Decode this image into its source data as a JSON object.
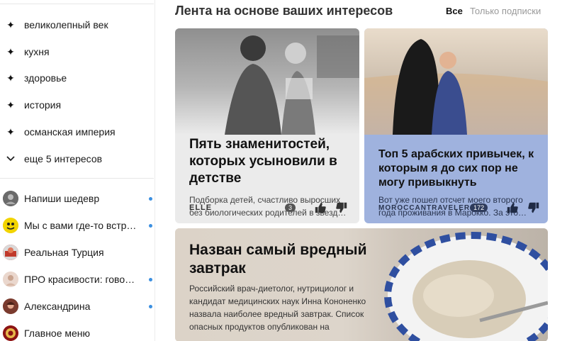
{
  "sidebar": {
    "topics": [
      {
        "label": "великолепный век",
        "icon": "sparkle-icon"
      },
      {
        "label": "кухня",
        "icon": "sparkle-icon"
      },
      {
        "label": "здоровье",
        "icon": "sparkle-icon"
      },
      {
        "label": "история",
        "icon": "sparkle-icon"
      },
      {
        "label": "османская империя",
        "icon": "sparkle-icon"
      }
    ],
    "more_label": "еще 5 интересов",
    "channels": [
      {
        "label": "Напиши шедевр",
        "unread": true
      },
      {
        "label": "Мы с вами где-то встреч…",
        "unread": true
      },
      {
        "label": "Реальная Турция",
        "unread": false
      },
      {
        "label": "ПРО красивости: говор…",
        "unread": true
      },
      {
        "label": "Александрина",
        "unread": true
      },
      {
        "label": "Главное меню",
        "unread": false
      }
    ]
  },
  "header": {
    "title": "Лента на основе ваших интересов",
    "filter_all": "Все",
    "filter_subscriptions": "Только подписки"
  },
  "cards": [
    {
      "title": "Пять знаменитостей, которых усыновили в детстве",
      "description": "Подборка детей, счастливо выросших без биологических родителей в звезд…",
      "source": "ELLE",
      "comments": "3"
    },
    {
      "title": "Топ 5 арабских привычек, к которым я до сих пор не могу привыкнуть",
      "description": "Вот уже пошел отсчет моего второго года проживания в Марокко. За это…",
      "source": "MOROCCANTRAVELER",
      "comments": "172"
    },
    {
      "title": "Назван самый вредный завтрак",
      "description": "Российский врач-диетолог, нутрициолог и кандидат медицинских наук Инна Кононенко назвала наиболее вредный завтрак. Список опасных продуктов опубликован на"
    }
  ],
  "colors": {
    "accent_dot": "#3b8fe0",
    "card2_bg": "#9fb2de"
  }
}
